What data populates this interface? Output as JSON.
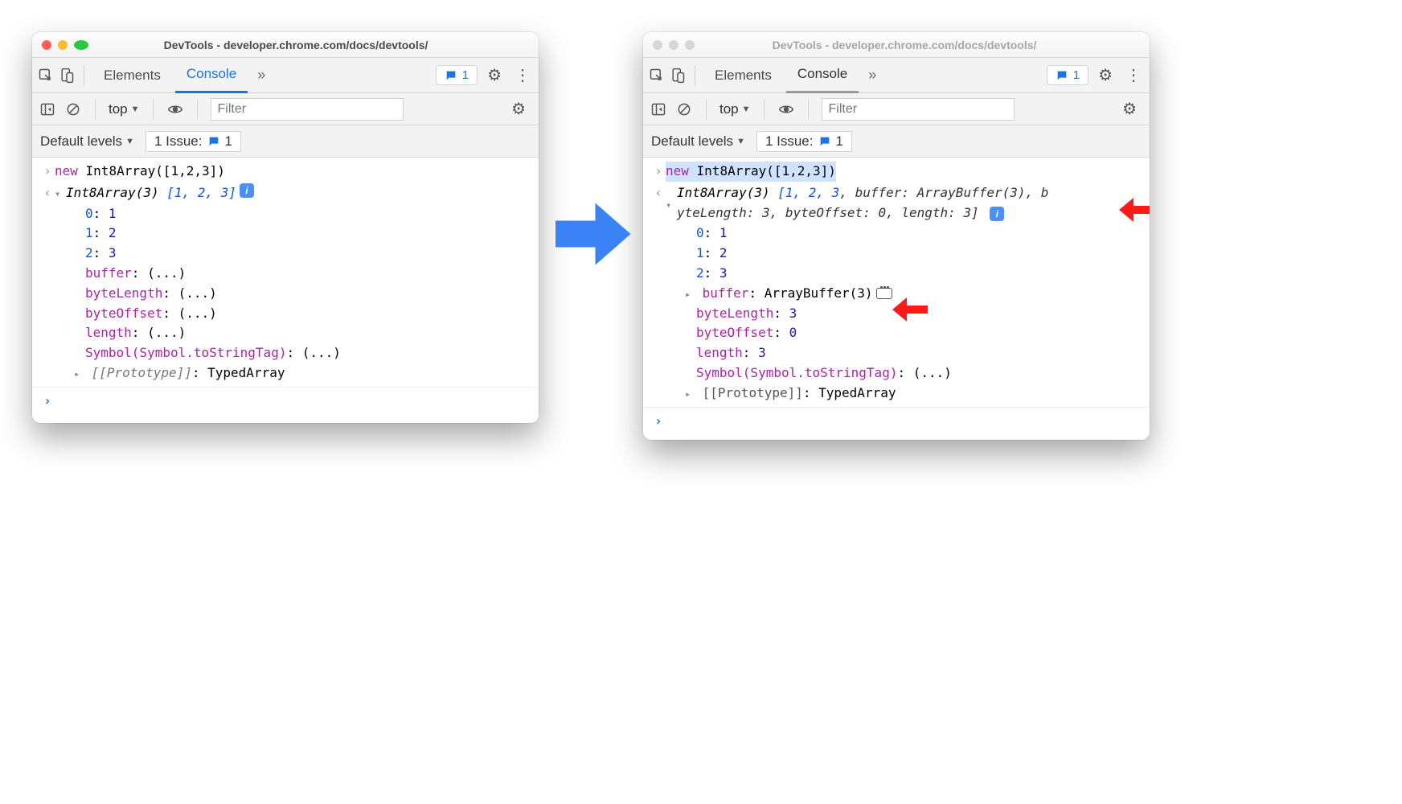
{
  "shared": {
    "title": "DevTools - developer.chrome.com/docs/devtools/",
    "tabs": {
      "elements": "Elements",
      "console": "Console"
    },
    "issues_badge": "1",
    "exec_context": "top",
    "filter_placeholder": "Filter",
    "default_levels": "Default levels",
    "issues_row": {
      "label": "1 Issue:",
      "count": "1"
    },
    "input_expr": {
      "kw": "new",
      "call": " Int8Array([1,2,3])"
    }
  },
  "left": {
    "summary_prefix": "Int8Array(3) ",
    "summary_vals": "[1, 2, 3]",
    "items": [
      {
        "k": "0",
        "v": "1"
      },
      {
        "k": "1",
        "v": "2"
      },
      {
        "k": "2",
        "v": "3"
      }
    ],
    "lazy": [
      {
        "k": "buffer",
        "v": "(...)"
      },
      {
        "k": "byteLength",
        "v": "(...)"
      },
      {
        "k": "byteOffset",
        "v": "(...)"
      },
      {
        "k": "length",
        "v": "(...)"
      },
      {
        "k": "Symbol(Symbol.toStringTag)",
        "v": "(...)"
      }
    ],
    "proto": {
      "k": "[[Prototype]]",
      "v": "TypedArray"
    }
  },
  "right": {
    "summary_line1": {
      "prefix": "Int8Array(3) ",
      "open": "[",
      "vals": "1, 2, 3",
      "rest": ", buffer: ArrayBuffer(3), b"
    },
    "summary_line2": "yteLength: 3, byteOffset: 0, length: 3]",
    "items": [
      {
        "k": "0",
        "v": "1"
      },
      {
        "k": "1",
        "v": "2"
      },
      {
        "k": "2",
        "v": "3"
      }
    ],
    "buffer": {
      "k": "buffer",
      "v": "ArrayBuffer(3)"
    },
    "eager": [
      {
        "k": "byteLength",
        "v": "3"
      },
      {
        "k": "byteOffset",
        "v": "0"
      },
      {
        "k": "length",
        "v": "3"
      }
    ],
    "symtag": {
      "k": "Symbol(Symbol.toStringTag)",
      "v": "(...)"
    },
    "proto": {
      "k": "[[Prototype]]",
      "v": "TypedArray"
    }
  }
}
